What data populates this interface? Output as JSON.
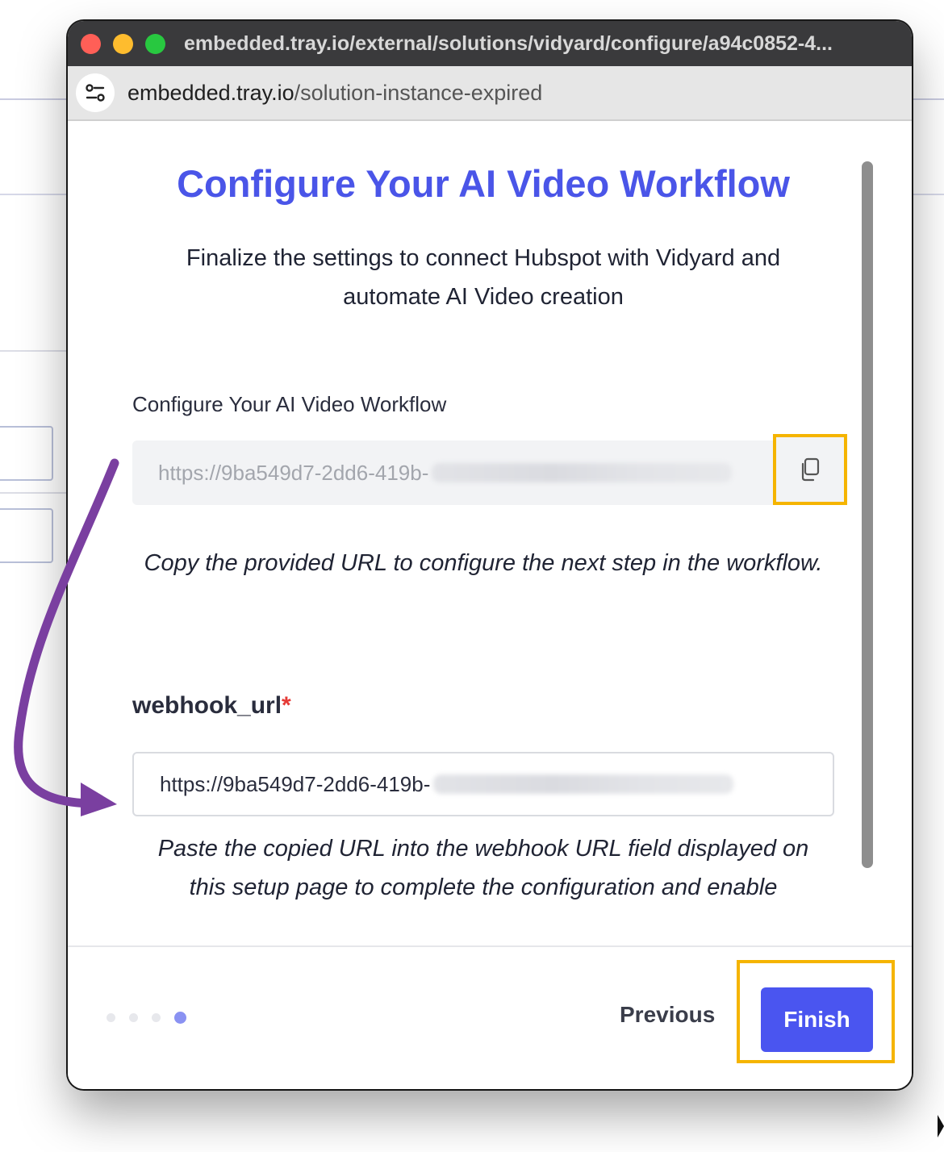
{
  "window": {
    "title": "embedded.tray.io/external/solutions/vidyard/configure/a94c0852-4...",
    "url_domain": "embedded.tray.io",
    "url_path": "/solution-instance-expired"
  },
  "page": {
    "heading": "Configure Your AI Video Workflow",
    "subtitle": "Finalize the settings to connect Hubspot with Vidyard and automate AI Video creation",
    "copy_field": {
      "label": "Configure Your AI Video Workflow",
      "value": "https://9ba549d7-2dd6-419b-"
    },
    "copy_helper": "Copy the provided URL to configure the next step in the workflow.",
    "webhook_field": {
      "label": "webhook_url",
      "required_mark": "*",
      "value": "https://9ba549d7-2dd6-419b-"
    },
    "paste_helper": "Paste the copied URL into the webhook URL field displayed on this setup page to complete the configuration and enable"
  },
  "footer": {
    "steps_total": 4,
    "current_step": 4,
    "previous_label": "Previous",
    "finish_label": "Finish"
  },
  "colors": {
    "accent": "#4a55f0",
    "highlight": "#f5b400",
    "annotation_arrow": "#7a3fa0"
  },
  "icons": {
    "site_settings": "tune-icon",
    "copy": "copy-icon"
  }
}
